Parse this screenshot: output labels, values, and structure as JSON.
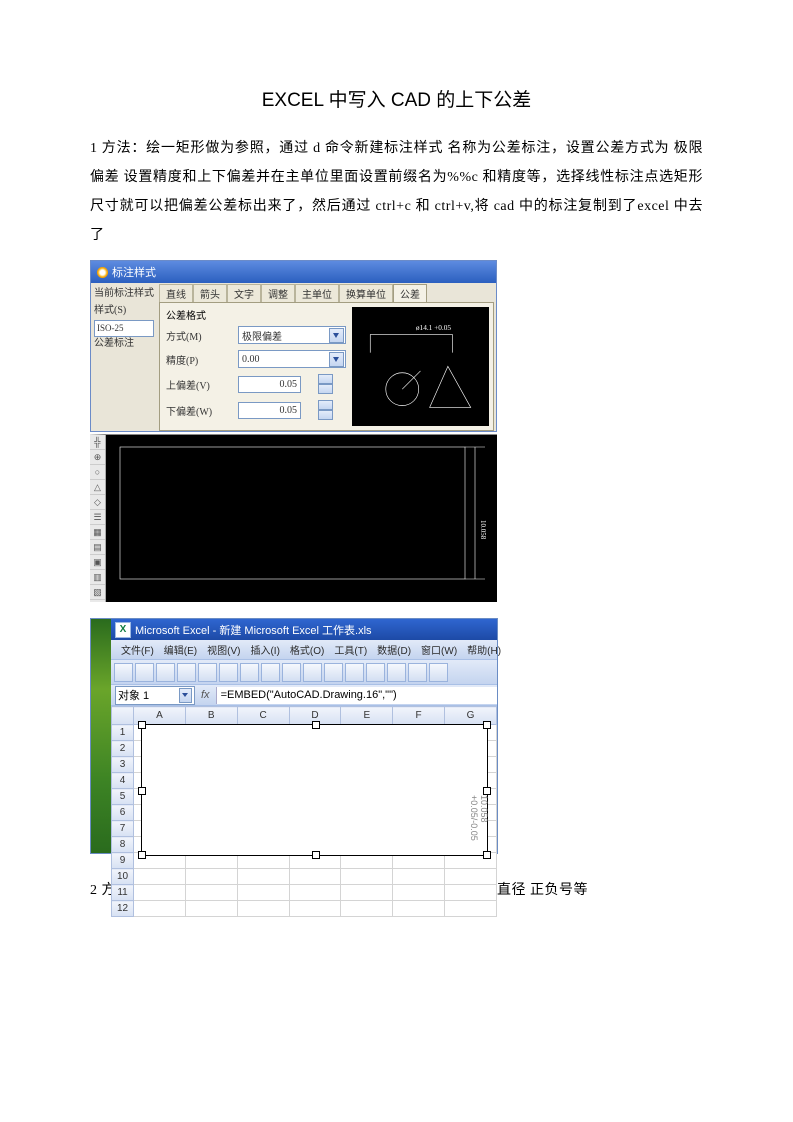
{
  "title": "EXCEL 中写入 CAD 的上下公差",
  "para1": "1 方法：绘一矩形做为参照，通过 d 命令新建标注样式 名称为公差标注，设置公差方式为 极限偏差 设置精度和上下偏差并在主单位里面设置前缀名为%%c 和精度等，选择线性标注点选矩形尺寸就可以把偏差公差标出来了，然后通过 ctrl+c 和 ctrl+v,将 cad 中的标注复制到了excel 中去了",
  "para2": "2 方法： 通过使用扩展工具里面的增强文字编辑器，在里面输入直径 正负号等",
  "fig1": {
    "titlebar": "标注样式",
    "left_panel": {
      "l1": "当前标注样式",
      "l2": "样式(S)",
      "opt": "ISO-25",
      "l3": "公差标注"
    },
    "tabs": [
      "直线",
      "箭头",
      "文字",
      "调整",
      "主单位",
      "换算单位",
      "公差"
    ],
    "form": {
      "group": "公差格式",
      "r1_label": "方式(M)",
      "r1_value": "极限偏差",
      "r2_label": "精度(P)",
      "r2_value": "0.00",
      "r3_label": "上偏差(V)",
      "r3_value": "0.05",
      "r4_label": "下偏差(W)",
      "r4_value": "0.05"
    },
    "preview_dim": "ø14.1 +0.05"
  },
  "fig2": {
    "tool_icons": [
      "╬",
      "⊕",
      "○",
      "△",
      "◇",
      "☰",
      "▦",
      "▤",
      "▣",
      "▥",
      "▧"
    ],
    "dim_text": "10.058"
  },
  "fig3": {
    "title_prefix": "Microsoft Excel - 新建 Microsoft Excel 工作表.xls",
    "menus": [
      "文件(F)",
      "编辑(E)",
      "视图(V)",
      "插入(I)",
      "格式(O)",
      "工具(T)",
      "数据(D)",
      "窗口(W)",
      "帮助(H)"
    ],
    "namebox": "对象 1",
    "formula": "=EMBED(\"AutoCAD.Drawing.16\",\"\")",
    "cols": [
      "A",
      "B",
      "C",
      "D",
      "E",
      "F",
      "G"
    ],
    "rows": [
      "1",
      "2",
      "3",
      "4",
      "5",
      "6",
      "7",
      "8",
      "9",
      "10",
      "11",
      "12"
    ],
    "object_dim": "10.058\n+0.05/-0.05"
  }
}
